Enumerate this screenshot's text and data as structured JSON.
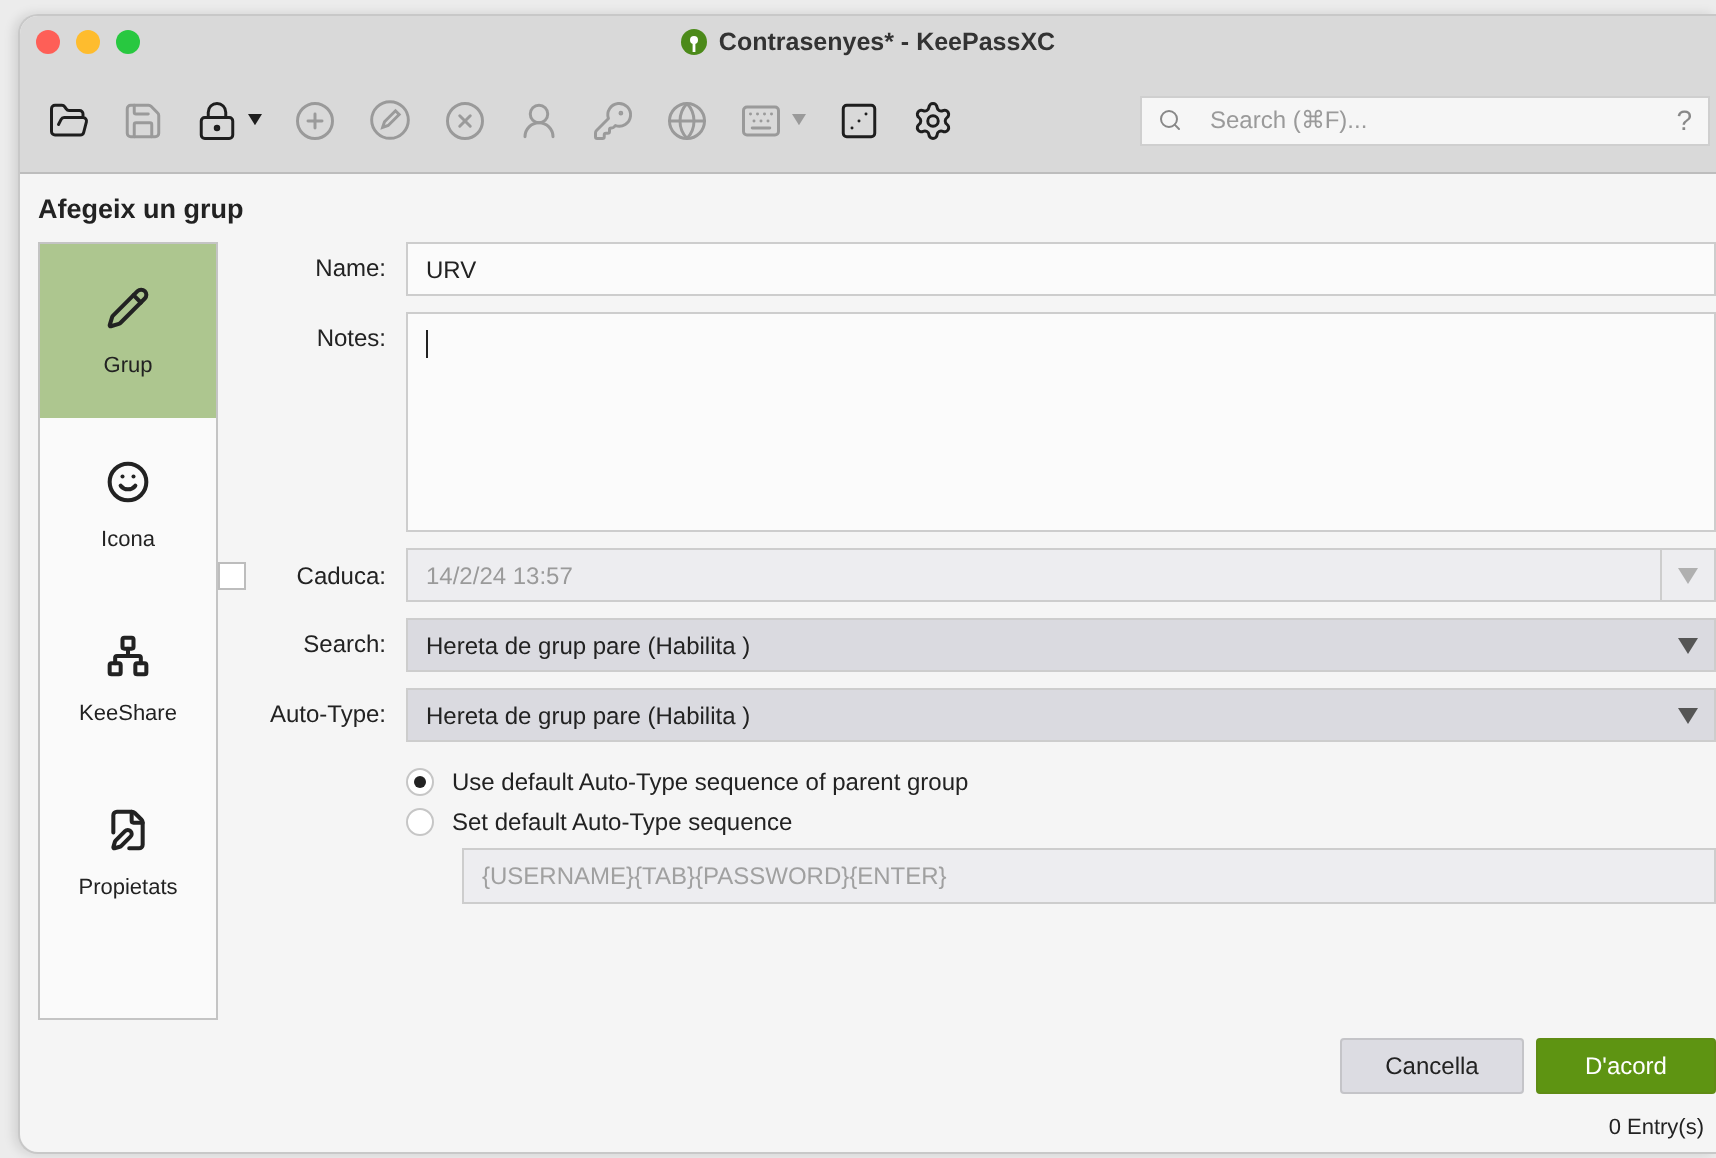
{
  "window": {
    "title": "Contrasenyes* - KeePassXC"
  },
  "toolbar": [
    {
      "kind": "button",
      "disabled": false
    },
    {
      "kind": "button",
      "disabled": true
    },
    {
      "kind": "dropdown",
      "disabled": false
    },
    {
      "kind": "button",
      "disabled": true
    },
    {
      "kind": "button",
      "disabled": true
    },
    {
      "kind": "button",
      "disabled": true
    },
    {
      "kind": "button",
      "disabled": true
    },
    {
      "kind": "button",
      "disabled": true
    },
    {
      "kind": "button",
      "disabled": true
    },
    {
      "kind": "dropdown",
      "disabled": true
    },
    {
      "kind": "button",
      "disabled": false
    },
    {
      "kind": "button",
      "disabled": false
    }
  ],
  "search": {
    "placeholder": "Search (⌘F)...",
    "help": "?"
  },
  "heading": "Afegeix un grup",
  "sidebar": {
    "items": [
      {
        "label": "Grup",
        "selected": true
      },
      {
        "label": "Icona",
        "selected": false
      },
      {
        "label": "KeeShare",
        "selected": false
      },
      {
        "label": "Propietats",
        "selected": false
      }
    ]
  },
  "form": {
    "name": {
      "label": "Name:",
      "value": "URV"
    },
    "notes": {
      "label": "Notes:"
    },
    "expires": {
      "label": "Caduca:",
      "checked": false,
      "disabled": true,
      "value": "14/2/24 13:57"
    },
    "search": {
      "label": "Search:",
      "value": "Hereta de grup pare (Habilita )"
    },
    "auto_type": {
      "label": "Auto-Type:",
      "value": "Hereta de grup pare (Habilita )"
    },
    "radios": [
      {
        "label": "Use default Auto-Type sequence of parent group",
        "selected": true
      },
      {
        "label": "Set default Auto-Type sequence",
        "selected": false
      }
    ],
    "sequence": {
      "placeholder": "{USERNAME}{TAB}{PASSWORD}{ENTER}"
    }
  },
  "buttons": [
    {
      "label": "Cancella",
      "kind": "secondary"
    },
    {
      "label": "D'acord",
      "kind": "primary"
    }
  ],
  "status_bar": "0 Entry(s)"
}
